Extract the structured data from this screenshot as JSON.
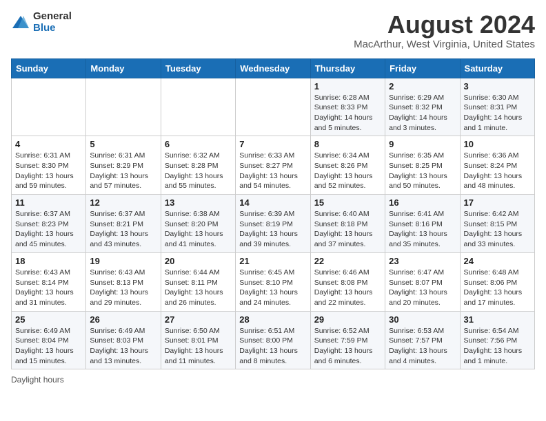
{
  "header": {
    "logo_general": "General",
    "logo_blue": "Blue",
    "month_year": "August 2024",
    "location": "MacArthur, West Virginia, United States"
  },
  "weekdays": [
    "Sunday",
    "Monday",
    "Tuesday",
    "Wednesday",
    "Thursday",
    "Friday",
    "Saturday"
  ],
  "weeks": [
    [
      {
        "day": "",
        "info": ""
      },
      {
        "day": "",
        "info": ""
      },
      {
        "day": "",
        "info": ""
      },
      {
        "day": "",
        "info": ""
      },
      {
        "day": "1",
        "info": "Sunrise: 6:28 AM\nSunset: 8:33 PM\nDaylight: 14 hours\nand 5 minutes."
      },
      {
        "day": "2",
        "info": "Sunrise: 6:29 AM\nSunset: 8:32 PM\nDaylight: 14 hours\nand 3 minutes."
      },
      {
        "day": "3",
        "info": "Sunrise: 6:30 AM\nSunset: 8:31 PM\nDaylight: 14 hours\nand 1 minute."
      }
    ],
    [
      {
        "day": "4",
        "info": "Sunrise: 6:31 AM\nSunset: 8:30 PM\nDaylight: 13 hours\nand 59 minutes."
      },
      {
        "day": "5",
        "info": "Sunrise: 6:31 AM\nSunset: 8:29 PM\nDaylight: 13 hours\nand 57 minutes."
      },
      {
        "day": "6",
        "info": "Sunrise: 6:32 AM\nSunset: 8:28 PM\nDaylight: 13 hours\nand 55 minutes."
      },
      {
        "day": "7",
        "info": "Sunrise: 6:33 AM\nSunset: 8:27 PM\nDaylight: 13 hours\nand 54 minutes."
      },
      {
        "day": "8",
        "info": "Sunrise: 6:34 AM\nSunset: 8:26 PM\nDaylight: 13 hours\nand 52 minutes."
      },
      {
        "day": "9",
        "info": "Sunrise: 6:35 AM\nSunset: 8:25 PM\nDaylight: 13 hours\nand 50 minutes."
      },
      {
        "day": "10",
        "info": "Sunrise: 6:36 AM\nSunset: 8:24 PM\nDaylight: 13 hours\nand 48 minutes."
      }
    ],
    [
      {
        "day": "11",
        "info": "Sunrise: 6:37 AM\nSunset: 8:23 PM\nDaylight: 13 hours\nand 45 minutes."
      },
      {
        "day": "12",
        "info": "Sunrise: 6:37 AM\nSunset: 8:21 PM\nDaylight: 13 hours\nand 43 minutes."
      },
      {
        "day": "13",
        "info": "Sunrise: 6:38 AM\nSunset: 8:20 PM\nDaylight: 13 hours\nand 41 minutes."
      },
      {
        "day": "14",
        "info": "Sunrise: 6:39 AM\nSunset: 8:19 PM\nDaylight: 13 hours\nand 39 minutes."
      },
      {
        "day": "15",
        "info": "Sunrise: 6:40 AM\nSunset: 8:18 PM\nDaylight: 13 hours\nand 37 minutes."
      },
      {
        "day": "16",
        "info": "Sunrise: 6:41 AM\nSunset: 8:16 PM\nDaylight: 13 hours\nand 35 minutes."
      },
      {
        "day": "17",
        "info": "Sunrise: 6:42 AM\nSunset: 8:15 PM\nDaylight: 13 hours\nand 33 minutes."
      }
    ],
    [
      {
        "day": "18",
        "info": "Sunrise: 6:43 AM\nSunset: 8:14 PM\nDaylight: 13 hours\nand 31 minutes."
      },
      {
        "day": "19",
        "info": "Sunrise: 6:43 AM\nSunset: 8:13 PM\nDaylight: 13 hours\nand 29 minutes."
      },
      {
        "day": "20",
        "info": "Sunrise: 6:44 AM\nSunset: 8:11 PM\nDaylight: 13 hours\nand 26 minutes."
      },
      {
        "day": "21",
        "info": "Sunrise: 6:45 AM\nSunset: 8:10 PM\nDaylight: 13 hours\nand 24 minutes."
      },
      {
        "day": "22",
        "info": "Sunrise: 6:46 AM\nSunset: 8:08 PM\nDaylight: 13 hours\nand 22 minutes."
      },
      {
        "day": "23",
        "info": "Sunrise: 6:47 AM\nSunset: 8:07 PM\nDaylight: 13 hours\nand 20 minutes."
      },
      {
        "day": "24",
        "info": "Sunrise: 6:48 AM\nSunset: 8:06 PM\nDaylight: 13 hours\nand 17 minutes."
      }
    ],
    [
      {
        "day": "25",
        "info": "Sunrise: 6:49 AM\nSunset: 8:04 PM\nDaylight: 13 hours\nand 15 minutes."
      },
      {
        "day": "26",
        "info": "Sunrise: 6:49 AM\nSunset: 8:03 PM\nDaylight: 13 hours\nand 13 minutes."
      },
      {
        "day": "27",
        "info": "Sunrise: 6:50 AM\nSunset: 8:01 PM\nDaylight: 13 hours\nand 11 minutes."
      },
      {
        "day": "28",
        "info": "Sunrise: 6:51 AM\nSunset: 8:00 PM\nDaylight: 13 hours\nand 8 minutes."
      },
      {
        "day": "29",
        "info": "Sunrise: 6:52 AM\nSunset: 7:59 PM\nDaylight: 13 hours\nand 6 minutes."
      },
      {
        "day": "30",
        "info": "Sunrise: 6:53 AM\nSunset: 7:57 PM\nDaylight: 13 hours\nand 4 minutes."
      },
      {
        "day": "31",
        "info": "Sunrise: 6:54 AM\nSunset: 7:56 PM\nDaylight: 13 hours\nand 1 minute."
      }
    ]
  ],
  "footer": {
    "note": "Daylight hours"
  }
}
